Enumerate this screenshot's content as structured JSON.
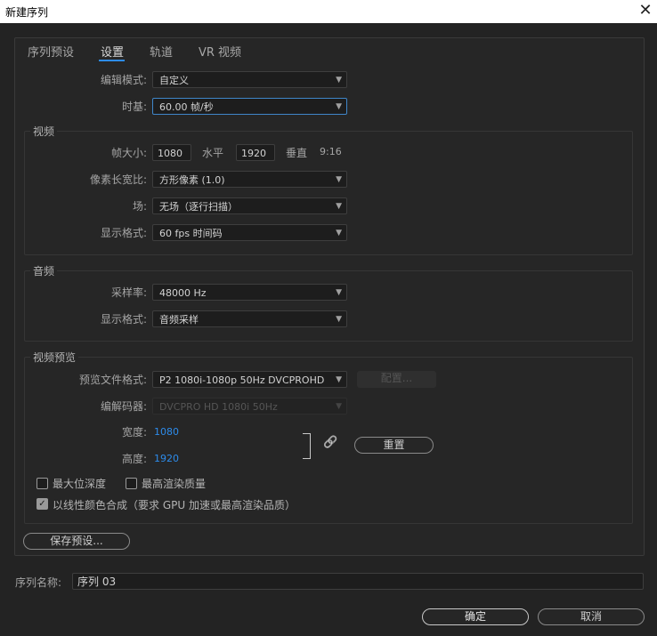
{
  "window": {
    "title": "新建序列",
    "close_glyph": "✕"
  },
  "tabs": [
    {
      "label": "序列预设",
      "active": false
    },
    {
      "label": "设置",
      "active": true
    },
    {
      "label": "轨道",
      "active": false
    },
    {
      "label": "VR 视频",
      "active": false
    }
  ],
  "settings": {
    "editing_mode_label": "编辑模式:",
    "editing_mode_value": "自定义",
    "timebase_label": "时基:",
    "timebase_value": "60.00  帧/秒"
  },
  "video": {
    "group_title": "视频",
    "frame_size_label": "帧大小:",
    "frame_width": "1080",
    "horizontal_label": "水平",
    "frame_height": "1920",
    "vertical_label": "垂直",
    "aspect_ratio": "9:16",
    "pixel_aspect_label": "像素长宽比:",
    "pixel_aspect_value": "方形像素 (1.0)",
    "fields_label": "场:",
    "fields_value": "无场（逐行扫描）",
    "display_format_label": "显示格式:",
    "display_format_value": "60 fps 时间码"
  },
  "audio": {
    "group_title": "音频",
    "sample_rate_label": "采样率:",
    "sample_rate_value": "48000 Hz",
    "display_format_label": "显示格式:",
    "display_format_value": "音频采样"
  },
  "preview": {
    "group_title": "视频预览",
    "file_format_label": "预览文件格式:",
    "file_format_value": "P2 1080i-1080p 50Hz DVCPROHD",
    "configure_label": "配置...",
    "codec_label": "编解码器:",
    "codec_value": "DVCPRO HD 1080i 50Hz",
    "width_label": "宽度:",
    "width_value": "1080",
    "height_label": "高度:",
    "height_value": "1920",
    "link_glyph": "🔗",
    "reset_label": "重置",
    "max_bit_depth_label": "最大位深度",
    "max_bit_depth_checked": false,
    "max_render_quality_label": "最高渲染质量",
    "max_render_quality_checked": false,
    "linear_color_label": "以线性颜色合成（要求 GPU 加速或最高渲染品质）",
    "linear_color_checked": true
  },
  "save_preset_label": "保存预设...",
  "sequence_name_label": "序列名称:",
  "sequence_name_value": "序列 03",
  "ok_label": "确定",
  "cancel_label": "取消",
  "accent_color": "#2d8ceb"
}
